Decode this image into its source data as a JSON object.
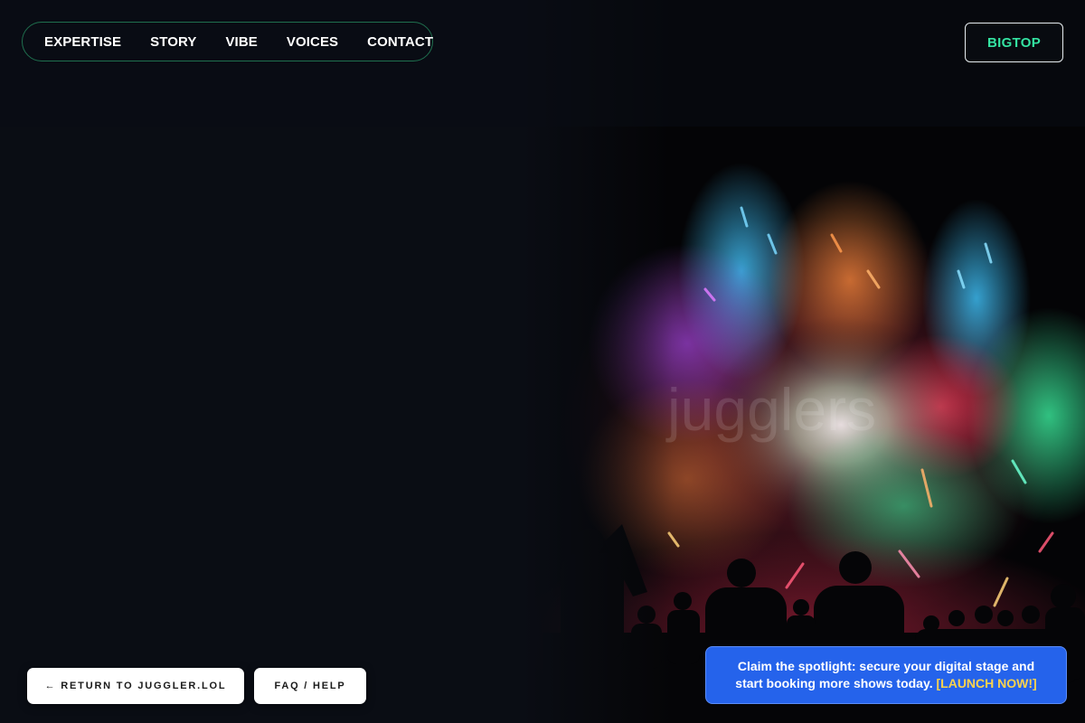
{
  "nav": {
    "items": [
      {
        "label": "EXPERTISE"
      },
      {
        "label": "STORY"
      },
      {
        "label": "VIBE"
      },
      {
        "label": "VOICES"
      },
      {
        "label": "CONTACT"
      }
    ]
  },
  "brand": {
    "label": "BIGTOP",
    "color": "#34e3a2"
  },
  "hero": {
    "watermark": "jugglers"
  },
  "footer_buttons": {
    "return_label": "← RETURN TO JUGGLER.LOL",
    "faq_label": "FAQ / HELP"
  },
  "promo": {
    "text": "Claim the spotlight: secure your digital stage and start booking more shows today.",
    "cta": "[LAUNCH NOW!]",
    "background": "#2563eb",
    "cta_color": "#fbd34d"
  },
  "colors": {
    "page_background": "#0a0d14",
    "nav_border": "#1f6f4e"
  }
}
